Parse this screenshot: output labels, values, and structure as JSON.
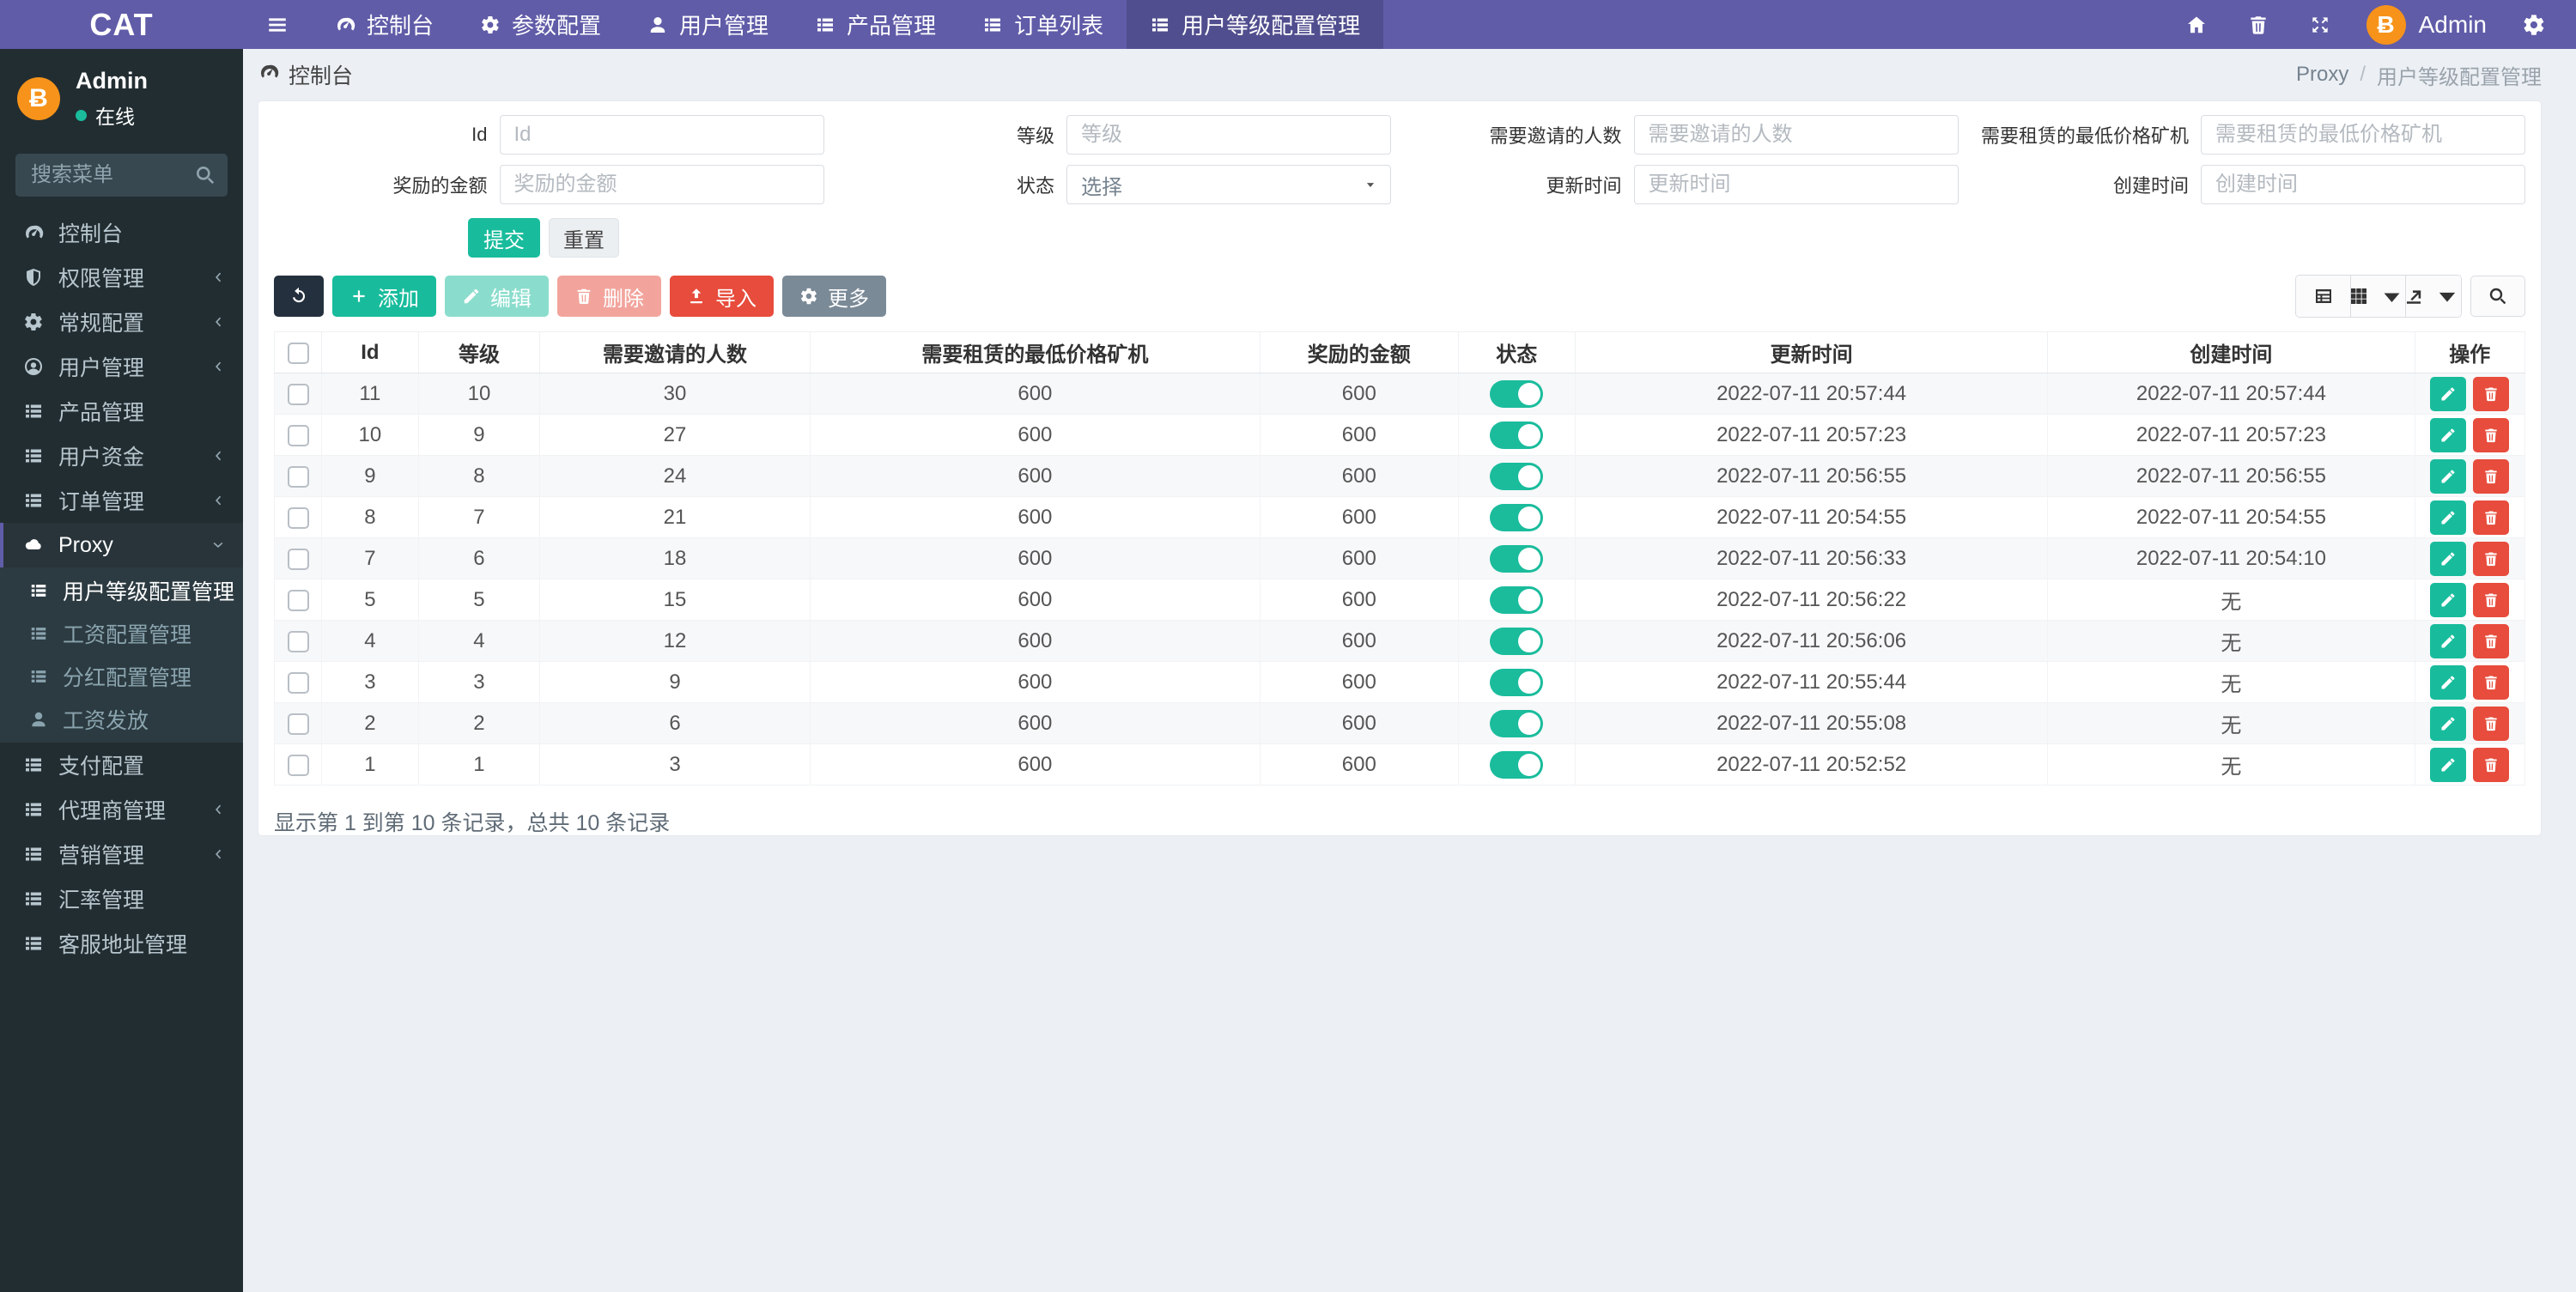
{
  "colors": {
    "navbar": "#605ca8",
    "sidebar": "#222d32",
    "accent_green": "#18bc9c",
    "danger_red": "#e74c3c",
    "avatar_orange": "#f7931a",
    "background": "#ecf0f5"
  },
  "navbar": {
    "brand": "CAT",
    "items": [
      {
        "id": "dashboard",
        "label": "控制台",
        "icon": "gauge-icon",
        "active": false
      },
      {
        "id": "params-config",
        "label": "参数配置",
        "icon": "gear-icon",
        "active": false
      },
      {
        "id": "user-management",
        "label": "用户管理",
        "icon": "user-icon",
        "active": false
      },
      {
        "id": "product-management",
        "label": "产品管理",
        "icon": "list-icon",
        "active": false
      },
      {
        "id": "order-list",
        "label": "订单列表",
        "icon": "list-icon",
        "active": false
      },
      {
        "id": "user-level-config",
        "label": "用户等级配置管理",
        "icon": "list-icon",
        "active": true
      }
    ],
    "user": {
      "name": "Admin",
      "avatar_symbol": "Ƀ"
    }
  },
  "sidebar": {
    "profile": {
      "name": "Admin",
      "status": "在线",
      "avatar_symbol": "Ƀ"
    },
    "search_placeholder": "搜索菜单",
    "items": [
      {
        "id": "dashboard",
        "label": "控制台",
        "icon": "gauge-icon"
      },
      {
        "id": "permission-management",
        "label": "权限管理",
        "icon": "shield-icon",
        "chevron": "left"
      },
      {
        "id": "general-config",
        "label": "常规配置",
        "icon": "gears-icon",
        "chevron": "left"
      },
      {
        "id": "user-management",
        "label": "用户管理",
        "icon": "user-circle-icon",
        "chevron": "left"
      },
      {
        "id": "product-management",
        "label": "产品管理",
        "icon": "list-icon"
      },
      {
        "id": "user-funds",
        "label": "用户资金",
        "icon": "list-icon",
        "chevron": "left"
      },
      {
        "id": "order-management",
        "label": "订单管理",
        "icon": "list-icon",
        "chevron": "left"
      },
      {
        "id": "proxy",
        "label": "Proxy",
        "icon": "cloud-icon",
        "chevron": "down",
        "active": true,
        "children": [
          {
            "id": "user-level-config",
            "label": "用户等级配置管理",
            "icon": "list-icon",
            "active": true
          },
          {
            "id": "salary-config",
            "label": "工资配置管理",
            "icon": "list-icon",
            "active": false
          },
          {
            "id": "dividend-config",
            "label": "分红配置管理",
            "icon": "list-icon",
            "active": false
          },
          {
            "id": "salary-payout",
            "label": "工资发放",
            "icon": "user-icon",
            "active": false
          }
        ]
      },
      {
        "id": "payment-config",
        "label": "支付配置",
        "icon": "list-icon"
      },
      {
        "id": "agent-management",
        "label": "代理商管理",
        "icon": "list-icon",
        "chevron": "left"
      },
      {
        "id": "marketing-management",
        "label": "营销管理",
        "icon": "list-icon",
        "chevron": "left"
      },
      {
        "id": "exchange-rate-management",
        "label": "汇率管理",
        "icon": "list-icon"
      },
      {
        "id": "service-address-management",
        "label": "客服地址管理",
        "icon": "list-icon"
      }
    ]
  },
  "breadcrumb": {
    "section": "控制台",
    "parent": "Proxy",
    "separator": "/",
    "current": "用户等级配置管理"
  },
  "filters": {
    "fields": [
      {
        "id": "id",
        "label": "Id",
        "placeholder": "Id",
        "type": "text"
      },
      {
        "id": "level",
        "label": "等级",
        "placeholder": "等级",
        "type": "text"
      },
      {
        "id": "invite-count",
        "label": "需要邀请的人数",
        "placeholder": "需要邀请的人数",
        "type": "text"
      },
      {
        "id": "min-rent-price",
        "label": "需要租赁的最低价格矿机",
        "placeholder": "需要租赁的最低价格矿机",
        "type": "text"
      },
      {
        "id": "reward-amount",
        "label": "奖励的金额",
        "placeholder": "奖励的金额",
        "type": "text"
      },
      {
        "id": "status",
        "label": "状态",
        "value": "选择",
        "type": "select"
      },
      {
        "id": "update-time",
        "label": "更新时间",
        "placeholder": "更新时间",
        "type": "text"
      },
      {
        "id": "create-time",
        "label": "创建时间",
        "placeholder": "创建时间",
        "type": "text"
      }
    ],
    "submit_label": "提交",
    "reset_label": "重置"
  },
  "toolbar": {
    "add": "添加",
    "edit": "编辑",
    "delete": "删除",
    "import": "导入",
    "more": "更多"
  },
  "table": {
    "headers": [
      "Id",
      "等级",
      "需要邀请的人数",
      "需要租赁的最低价格矿机",
      "奖励的金额",
      "状态",
      "更新时间",
      "创建时间",
      "操作"
    ],
    "rows": [
      {
        "id": "11",
        "level": "10",
        "invites": "30",
        "min_rent": "600",
        "reward": "600",
        "status": "on",
        "updated": "2022-07-11 20:57:44",
        "created": "2022-07-11 20:57:44"
      },
      {
        "id": "10",
        "level": "9",
        "invites": "27",
        "min_rent": "600",
        "reward": "600",
        "status": "on",
        "updated": "2022-07-11 20:57:23",
        "created": "2022-07-11 20:57:23"
      },
      {
        "id": "9",
        "level": "8",
        "invites": "24",
        "min_rent": "600",
        "reward": "600",
        "status": "on",
        "updated": "2022-07-11 20:56:55",
        "created": "2022-07-11 20:56:55"
      },
      {
        "id": "8",
        "level": "7",
        "invites": "21",
        "min_rent": "600",
        "reward": "600",
        "status": "on",
        "updated": "2022-07-11 20:54:55",
        "created": "2022-07-11 20:54:55"
      },
      {
        "id": "7",
        "level": "6",
        "invites": "18",
        "min_rent": "600",
        "reward": "600",
        "status": "on",
        "updated": "2022-07-11 20:56:33",
        "created": "2022-07-11 20:54:10"
      },
      {
        "id": "5",
        "level": "5",
        "invites": "15",
        "min_rent": "600",
        "reward": "600",
        "status": "on",
        "updated": "2022-07-11 20:56:22",
        "created": "无"
      },
      {
        "id": "4",
        "level": "4",
        "invites": "12",
        "min_rent": "600",
        "reward": "600",
        "status": "on",
        "updated": "2022-07-11 20:56:06",
        "created": "无"
      },
      {
        "id": "3",
        "level": "3",
        "invites": "9",
        "min_rent": "600",
        "reward": "600",
        "status": "on",
        "updated": "2022-07-11 20:55:44",
        "created": "无"
      },
      {
        "id": "2",
        "level": "2",
        "invites": "6",
        "min_rent": "600",
        "reward": "600",
        "status": "on",
        "updated": "2022-07-11 20:55:08",
        "created": "无"
      },
      {
        "id": "1",
        "level": "1",
        "invites": "3",
        "min_rent": "600",
        "reward": "600",
        "status": "on",
        "updated": "2022-07-11 20:52:52",
        "created": "无"
      }
    ]
  },
  "footer": {
    "summary": "显示第 1 到第 10 条记录，总共 10 条记录"
  }
}
